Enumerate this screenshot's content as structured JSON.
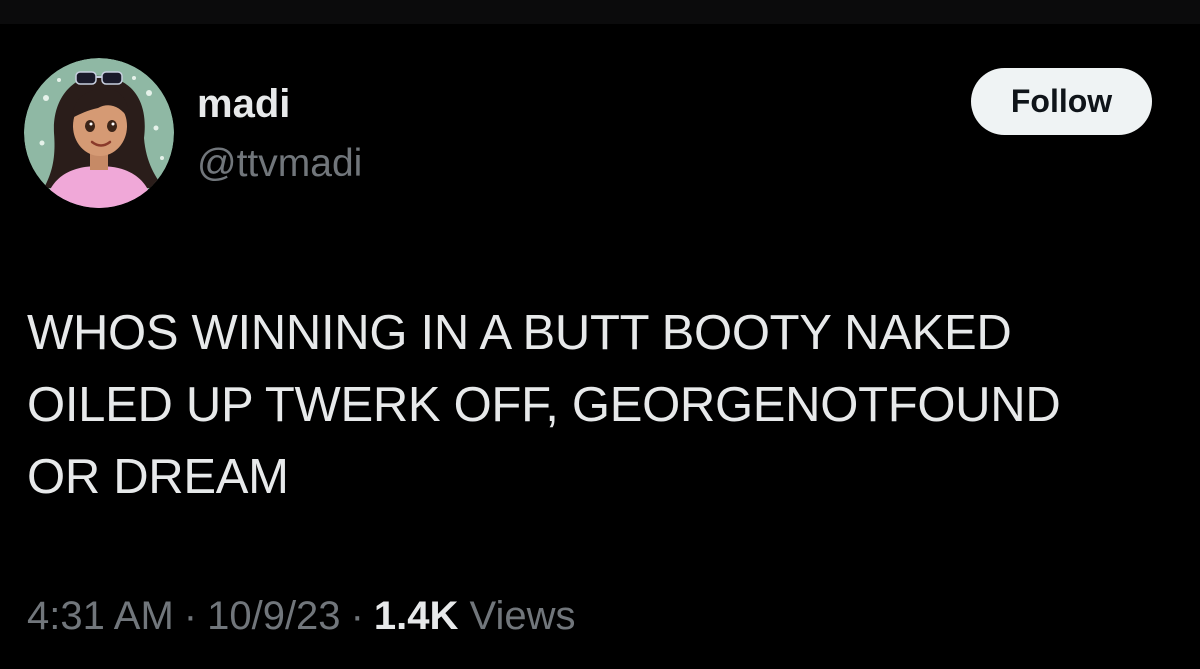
{
  "author": {
    "display_name": "madi",
    "handle": "@ttvmadi",
    "avatar": "avatar-illustration"
  },
  "follow_label": "Follow",
  "tweet": {
    "lines": [
      "WHOS WINNING IN A BUTT BOOTY NAKED",
      "OILED UP TWERK OFF, GEORGENOTFOUND",
      "OR DREAM"
    ]
  },
  "meta": {
    "time": "4:31 AM",
    "separator": "·",
    "date": "10/9/23",
    "views_count": "1.4K",
    "views_label": "Views"
  },
  "colors": {
    "background": "#000000",
    "text": "#e7e9ea",
    "secondary": "#71767b",
    "button_bg": "#eff3f4",
    "button_text": "#0f1419"
  }
}
